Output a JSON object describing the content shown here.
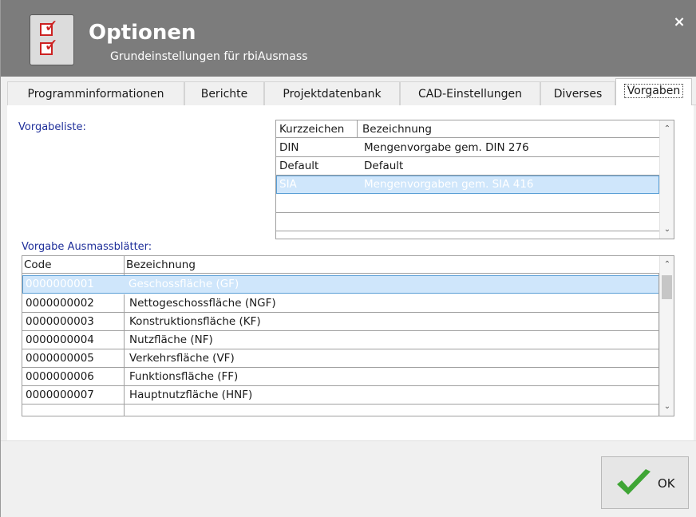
{
  "header": {
    "title": "Optionen",
    "subtitle": "Grundeinstellungen für rbiAusmass",
    "close_symbol": "×"
  },
  "tabs": [
    {
      "label": "Programminformationen"
    },
    {
      "label": "Berichte"
    },
    {
      "label": "Projektdatenbank"
    },
    {
      "label": "CAD-Einstellungen"
    },
    {
      "label": "Diverses"
    },
    {
      "label": "Vorgaben"
    }
  ],
  "active_tab": "Vorgaben",
  "vorgabeliste": {
    "label": "Vorgabeliste:",
    "columns": [
      "Kurzzeichen",
      "Bezeichnung"
    ],
    "rows": [
      {
        "kurz": "DIN",
        "bez": "Mengenvorgabe gem. DIN 276"
      },
      {
        "kurz": "Default",
        "bez": "Default"
      },
      {
        "kurz": "SIA",
        "bez": "Mengenvorgaben gem. SIA 416"
      }
    ],
    "selected_index": 2
  },
  "ausmassblaetter": {
    "label": "Vorgabe Ausmassblätter:",
    "columns": [
      "Code",
      "Bezeichnung"
    ],
    "rows": [
      {
        "code": "0000000001",
        "bez": "Geschossfläche (GF)"
      },
      {
        "code": "0000000002",
        "bez": "Nettogeschossfläche (NGF)"
      },
      {
        "code": "0000000003",
        "bez": "Konstruktionsfläche (KF)"
      },
      {
        "code": "0000000004",
        "bez": "Nutzfläche (NF)"
      },
      {
        "code": "0000000005",
        "bez": "Verkehrsfläche (VF)"
      },
      {
        "code": "0000000006",
        "bez": "Funktionsfläche (FF)"
      },
      {
        "code": "0000000007",
        "bez": "Hauptnutzfläche (HNF)"
      }
    ],
    "selected_index": 0
  },
  "footer": {
    "ok_label": "OK"
  },
  "colors": {
    "header_bg": "#7c7c7c",
    "label_blue": "#1f2f9a",
    "selection_bg": "#cfe6fb",
    "ok_green": "#3fa535"
  },
  "icons": {
    "app": "checklist-icon",
    "close": "close-icon",
    "ok": "checkmark-icon",
    "scroll_up": "chevron-up-icon",
    "scroll_down": "chevron-down-icon"
  }
}
